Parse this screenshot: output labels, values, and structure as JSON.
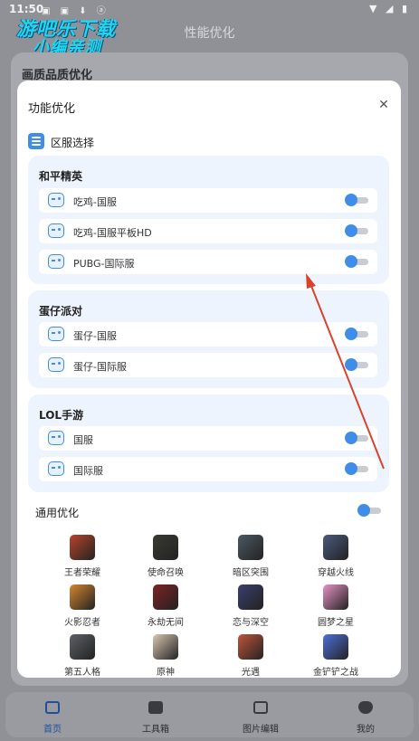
{
  "status_bar": {
    "time": "11:50"
  },
  "watermark": {
    "line1": "游吧乐下载",
    "line2": "小编亲测"
  },
  "page": {
    "title": "性能优化",
    "section_title": "画质品质优化"
  },
  "modal": {
    "title": "功能优化",
    "region_label": "区服选择",
    "groups": [
      {
        "title": "和平精英",
        "items": [
          {
            "label": "吃鸡-国服"
          },
          {
            "label": "吃鸡-国服平板HD"
          },
          {
            "label": "PUBG-国际服"
          }
        ]
      },
      {
        "title": "蛋仔派对",
        "items": [
          {
            "label": "蛋仔-国服"
          },
          {
            "label": "蛋仔-国际服"
          }
        ]
      },
      {
        "title": "LOL手游",
        "items": [
          {
            "label": "国服"
          },
          {
            "label": "国际服"
          }
        ]
      }
    ],
    "general_label": "通用优化",
    "games": [
      {
        "name": "王者荣耀",
        "color": "#b8452a"
      },
      {
        "name": "使命召唤",
        "color": "#3a3a32"
      },
      {
        "name": "暗区突围",
        "color": "#4c5963"
      },
      {
        "name": "穿越火线",
        "color": "#4a5a7e"
      },
      {
        "name": "火影忍者",
        "color": "#d4862e"
      },
      {
        "name": "永劫无间",
        "color": "#7d2324"
      },
      {
        "name": "恋与深空",
        "color": "#3a3f6c"
      },
      {
        "name": "圆梦之星",
        "color": "#e792c4"
      },
      {
        "name": "第五人格",
        "color": "#5c6066"
      },
      {
        "name": "原神",
        "color": "#d9c6b0"
      },
      {
        "name": "光遇",
        "color": "#c0553a"
      },
      {
        "name": "金铲铲之战",
        "color": "#4d6fd8"
      }
    ]
  },
  "nav": [
    {
      "label": "首页",
      "active": true
    },
    {
      "label": "工具箱"
    },
    {
      "label": "图片编辑"
    },
    {
      "label": "我的"
    }
  ],
  "colors": {
    "accent": "#3f8de9",
    "group_bg": "#eef4fd",
    "toggle_track": "#c9ccd1",
    "annotation_arrow": "#d9432c"
  }
}
